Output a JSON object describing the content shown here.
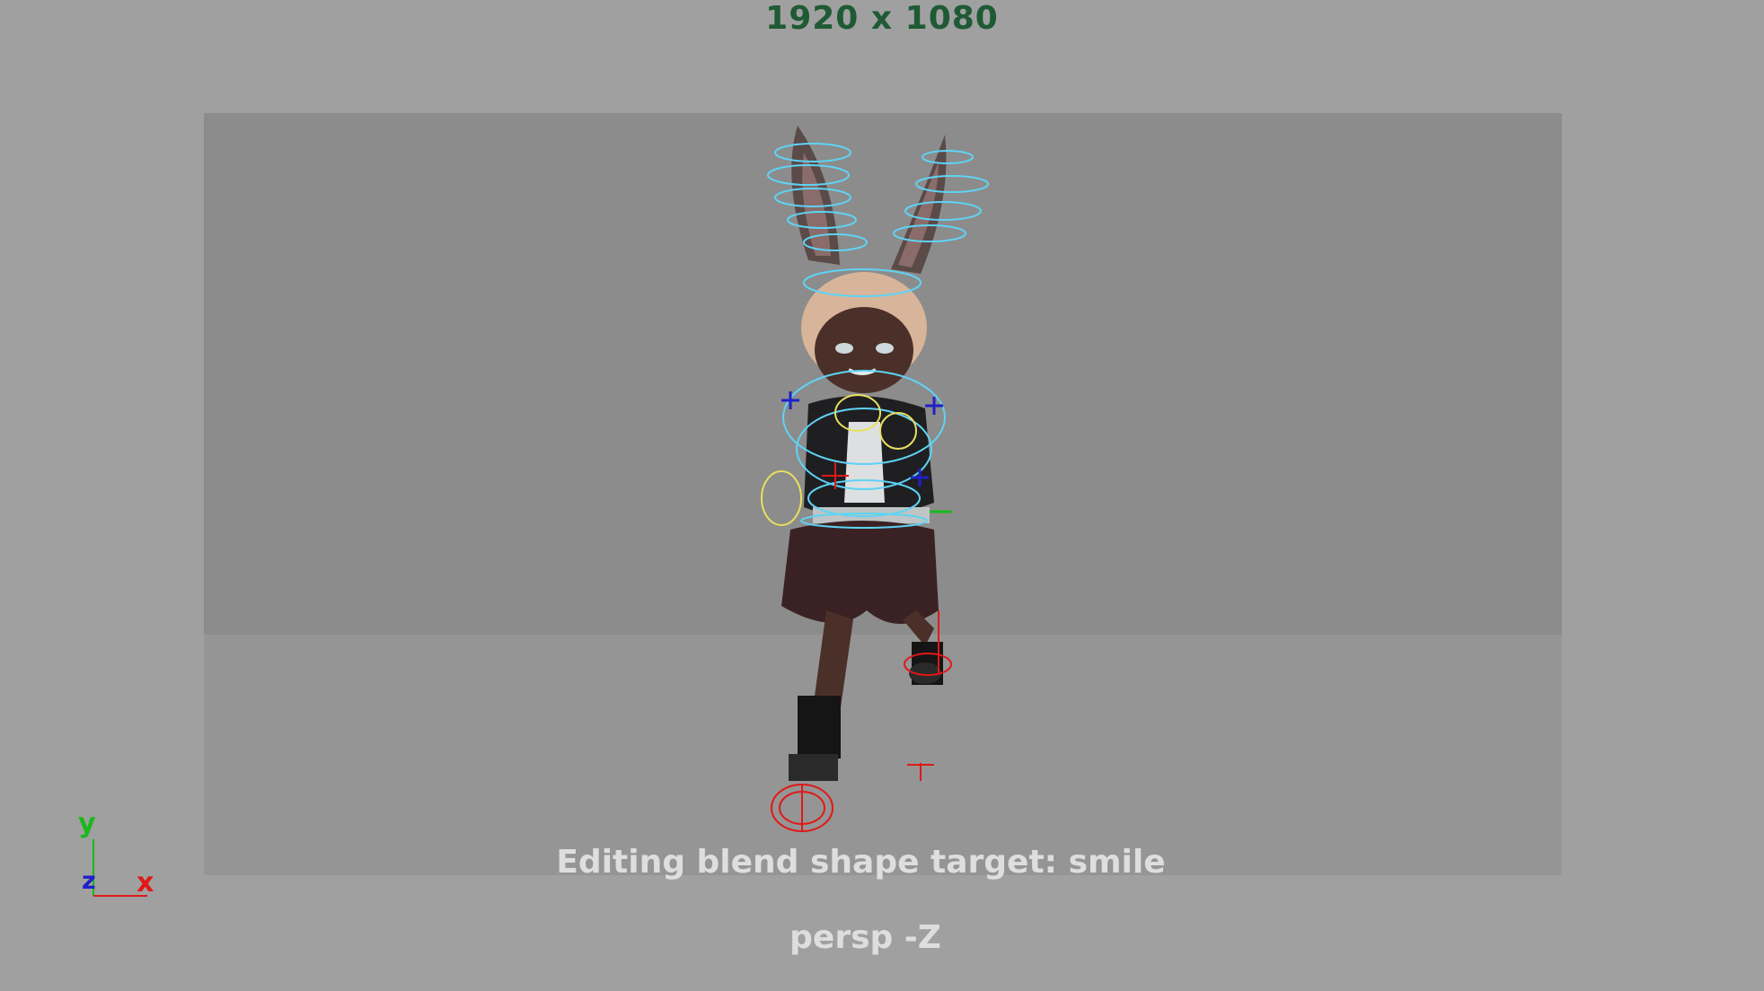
{
  "viewport": {
    "resolution_label": "1920 x 1080",
    "status_message": "Editing blend shape target: smile",
    "camera_label": "persp -Z"
  },
  "axis_gizmo": {
    "y": "y",
    "z": "z",
    "x": "x",
    "colors": {
      "y": "#1ab81a",
      "z": "#2020c8",
      "x": "#e01818"
    }
  },
  "colors": {
    "background": "#a0a0a0",
    "resolution_gate": "#8f8f8f",
    "resolution_text": "#1e5a34",
    "hud_text": "#dedede",
    "control_curve_primary": "#5fd3f5",
    "control_curve_secondary": "#e8e060",
    "control_curve_ik": "#e01818"
  }
}
